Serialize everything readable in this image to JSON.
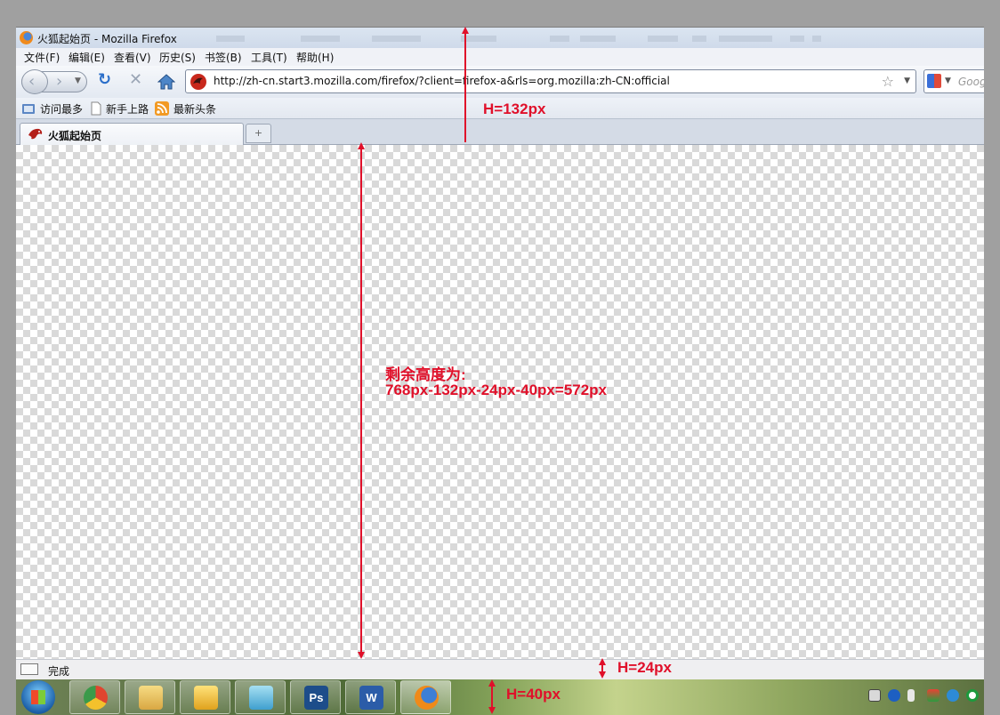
{
  "window": {
    "title": "火狐起始页 - Mozilla Firefox"
  },
  "menubar": {
    "items": [
      "文件(F)",
      "编辑(E)",
      "查看(V)",
      "历史(S)",
      "书签(B)",
      "工具(T)",
      "帮助(H)"
    ]
  },
  "navbar": {
    "url": "http://zh-cn.start3.mozilla.com/firefox/?client=firefox-a&rls=org.mozilla:zh-CN:official",
    "search_placeholder": "Goog"
  },
  "bookmarks": {
    "items": [
      "访问最多",
      "新手上路",
      "最新头条"
    ]
  },
  "tabs": [
    {
      "label": "火狐起始页"
    }
  ],
  "newtab_symbol": "+",
  "statusbar": {
    "text": "完成"
  },
  "taskbar": {
    "apps": [
      "chrome",
      "file-explorer",
      "outlook",
      "notepad",
      "photoshop",
      "word",
      "firefox"
    ],
    "labels": {
      "photoshop": "Ps",
      "word": "W"
    }
  },
  "annotations": {
    "toolbar_height": "H=132px",
    "remaining_title": "剩余高度为:",
    "remaining_formula": "768px-132px-24px-40px=572px",
    "statusbar_height": "H=24px",
    "taskbar_height": "H=40px"
  },
  "colors": {
    "annotation": "#e0102a",
    "checker_light": "#ffffff",
    "checker_dark": "#d9d9d9"
  }
}
